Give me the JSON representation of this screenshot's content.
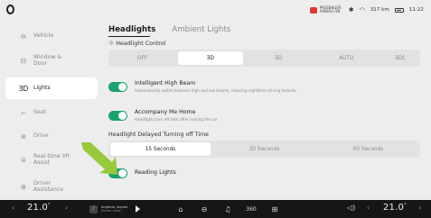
{
  "status": {
    "airbag_text": "PASSENGER AIRBAG ON",
    "range": "317 km",
    "time": "11:22"
  },
  "sidebar": {
    "items": [
      {
        "label": "Vehicle",
        "icon": "car-icon"
      },
      {
        "label": "Window & Door",
        "icon": "window-icon"
      },
      {
        "label": "Lights",
        "icon": "lights-icon"
      },
      {
        "label": "Seat",
        "icon": "seat-icon"
      },
      {
        "label": "Drive",
        "icon": "steering-icon"
      },
      {
        "label": "Real-time VR Assist",
        "icon": "vr-assist-icon"
      },
      {
        "label": "Driver Assistance",
        "icon": "driver-assist-icon"
      }
    ],
    "active_index": 2
  },
  "tabs": [
    {
      "label": "Headlights"
    },
    {
      "label": "Ambient Lights"
    }
  ],
  "headlight_control": {
    "title": "Headlight Control",
    "options": [
      "OFF",
      "ƎD",
      "ƎD",
      "AUTO",
      "ƎDƐ"
    ],
    "selected_index": 1
  },
  "intelligent_high_beam": {
    "title": "Intelligent High Beam",
    "subtitle": "Automatically switch between high and low beams, reducing nighttime driving hazards",
    "enabled": true
  },
  "accompany_me_home": {
    "title": "Accompany Me Home",
    "subtitle": "Headlights turn off later after locking the car",
    "enabled": true
  },
  "delay_off": {
    "title": "Headlight Delayed Turning off Time",
    "options": [
      "15 Seconds",
      "30 Seconds",
      "60 Seconds"
    ],
    "selected_index": 0
  },
  "reading_lights": {
    "title": "Reading Lights",
    "enabled": true
  },
  "dock": {
    "left_temp": "21.0",
    "right_temp": "21.0",
    "temp_unit": "°",
    "media_title": "Anytime, Anywh",
    "media_sub": "Radmi radio",
    "icons": [
      "home-icon",
      "car-icon",
      "music-icon",
      "360-view-icon",
      "apps-icon"
    ],
    "icon_labels": [
      "⌂",
      "🚗",
      "♫",
      "360",
      "⊞"
    ]
  },
  "colors": {
    "accent_green": "#17a36b",
    "background": "#ededed",
    "dock": "#161616"
  }
}
